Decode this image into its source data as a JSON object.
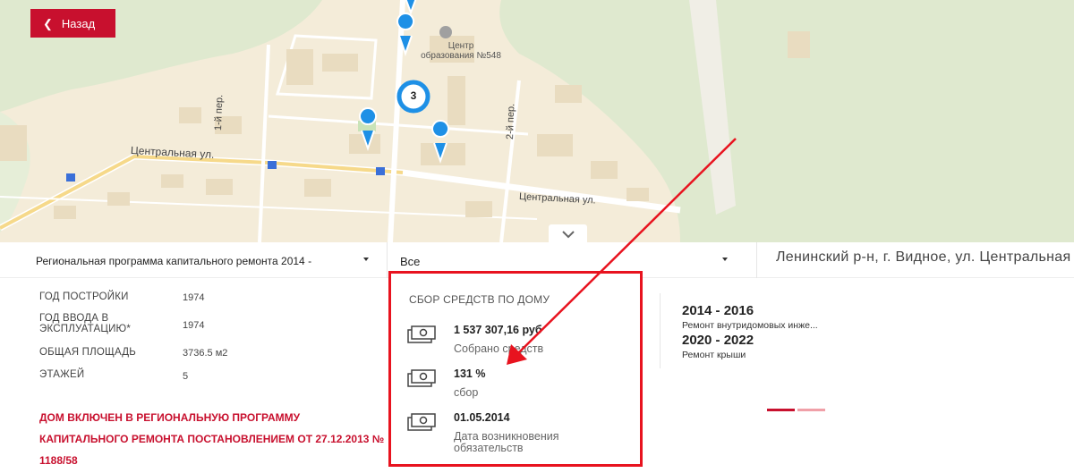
{
  "colors": {
    "brand_red": "#c8102e",
    "highlight_red": "#e8131f",
    "map_marker_blue": "#1e90e6"
  },
  "header": {
    "back_label": "Назад"
  },
  "map": {
    "street_labels": {
      "central_1": "Центральная ул.",
      "central_2": "Центральная ул.",
      "lane_1": "1-й пер.",
      "lane_2": "2-й пер."
    },
    "poi_line1": "Центр",
    "poi_line2": "образования №548",
    "cluster_count": "3"
  },
  "filters": {
    "program_selected": "Региональная программа капитального ремонта 2014 -",
    "type_selected": "Все",
    "address": "Ленинский р-н, г. Видное, ул. Центральная"
  },
  "building_info": [
    {
      "label": "Год постройки",
      "value": "1974"
    },
    {
      "label": "Год ввода в эксплуатацию*",
      "value": "1974"
    },
    {
      "label": "Общая площадь",
      "value": "3736.5 м2"
    },
    {
      "label": "Этажей",
      "value": "5"
    }
  ],
  "notice": "Дом включен в региональную программу капитального ремонта постановлением от 27.12.2013 № 1188/58",
  "funds": {
    "title": "Сбор средств по дому",
    "items": [
      {
        "icon": "money-icon",
        "value": "1 537 307,16 руб",
        "caption": "Собрано средств"
      },
      {
        "icon": "money-icon",
        "value": "131 %",
        "caption": "сбор"
      },
      {
        "icon": "money-icon",
        "value": "01.05.2014",
        "caption": "Дата возникновения обязательств"
      }
    ]
  },
  "repairs": [
    {
      "period": "2014 - 2016",
      "work": "Ремонт внутридомовых инже..."
    },
    {
      "period": "2020 - 2022",
      "work": "Ремонт крыши"
    }
  ],
  "pager": {
    "active_color": "#c8102e",
    "inactive_color": "#f0a0a8"
  }
}
